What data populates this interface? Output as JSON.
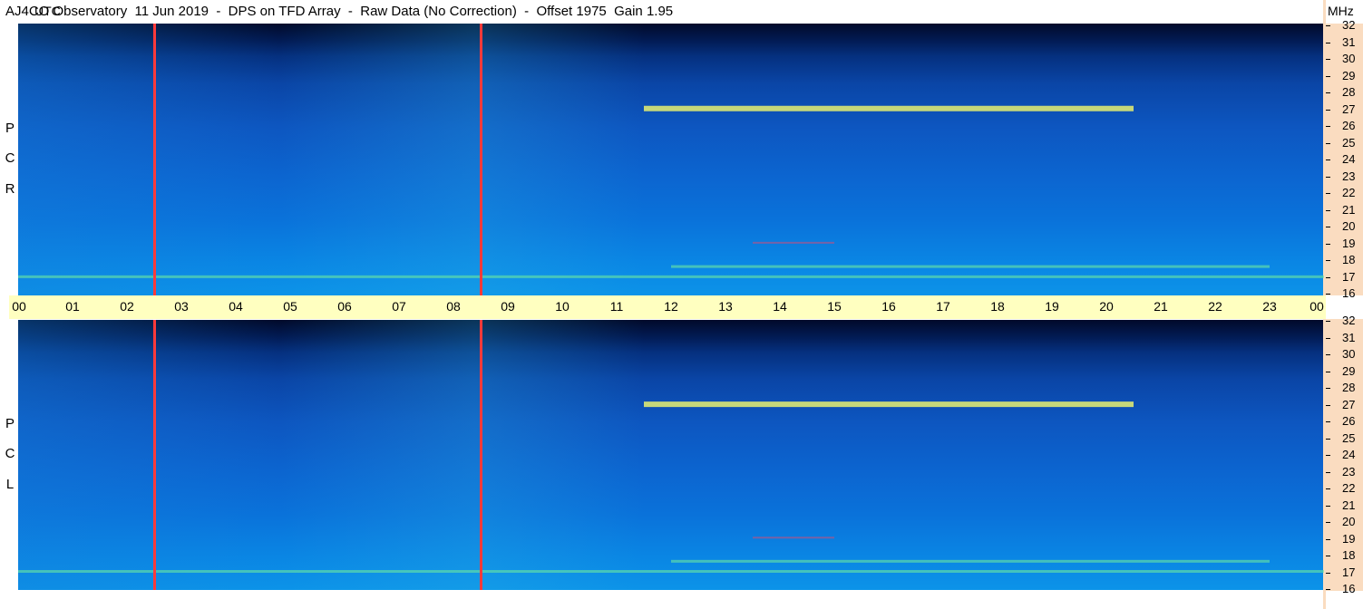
{
  "title": "AJ4CO Observatory  11 Jun 2019  -  DPS on TFD Array  -  Raw Data (No Correction)  -  Offset 1975  Gain 1.95",
  "panels": [
    {
      "name": "RCP",
      "label_letters": [
        "P",
        "C",
        "R"
      ]
    },
    {
      "name": "LCP",
      "label_letters": [
        "P",
        "C",
        "L"
      ]
    }
  ],
  "time_axis": {
    "utc_label": "UTC",
    "mhz_label": "MHz",
    "ticks": [
      "00",
      "01",
      "02",
      "03",
      "04",
      "05",
      "06",
      "07",
      "08",
      "09",
      "10",
      "11",
      "12",
      "13",
      "14",
      "15",
      "16",
      "17",
      "18",
      "19",
      "20",
      "21",
      "22",
      "23",
      "00"
    ]
  },
  "freq_axis": {
    "ticks": [
      "32",
      "31",
      "30",
      "29",
      "28",
      "27",
      "26",
      "25",
      "24",
      "23",
      "22",
      "21",
      "20",
      "19",
      "18",
      "17",
      "16"
    ],
    "range_mhz": [
      16,
      32
    ]
  },
  "colors": {
    "background_deep": "#010a2a",
    "background_mid": "#0c64cf",
    "background_low": "#0c93e8",
    "time_bar": "#ffffc0",
    "freq_axis": "#fadcc0",
    "marker_line": "#ff3a3a",
    "band_yellow": "#e8f070",
    "band_green": "#6ae8a0"
  },
  "chart_data": {
    "type": "heatmap",
    "title": "AJ4CO Observatory  11 Jun 2019  -  DPS on TFD Array  -  Raw Data (No Correction)  -  Offset 1975  Gain 1.95",
    "xlabel": "UTC",
    "ylabel": "MHz",
    "x_range_hours": [
      0,
      24
    ],
    "y_range_mhz": [
      16,
      32
    ],
    "panels": [
      "RCP",
      "LCP"
    ],
    "vertical_markers_utc_hours": [
      2.5,
      8.5
    ],
    "features": [
      {
        "type": "band",
        "panel": "RCP",
        "freq_mhz": 27.0,
        "start_h": 11.5,
        "end_h": 20.5,
        "intensity": "high"
      },
      {
        "type": "band",
        "panel": "LCP",
        "freq_mhz": 27.0,
        "start_h": 11.5,
        "end_h": 20.5,
        "intensity": "high"
      },
      {
        "type": "band",
        "panel": "RCP",
        "freq_mhz": 17.1,
        "start_h": 0.0,
        "end_h": 24.0,
        "intensity": "medium"
      },
      {
        "type": "band",
        "panel": "LCP",
        "freq_mhz": 17.1,
        "start_h": 0.0,
        "end_h": 24.0,
        "intensity": "medium"
      },
      {
        "type": "band",
        "panel": "RCP",
        "freq_mhz": 17.7,
        "start_h": 12.0,
        "end_h": 23.0,
        "intensity": "medium"
      },
      {
        "type": "band",
        "panel": "LCP",
        "freq_mhz": 17.7,
        "start_h": 12.0,
        "end_h": 23.0,
        "intensity": "medium"
      },
      {
        "type": "band",
        "panel": "RCP",
        "freq_mhz": 19.1,
        "start_h": 13.5,
        "end_h": 15.0,
        "intensity": "low"
      },
      {
        "type": "band",
        "panel": "LCP",
        "freq_mhz": 19.1,
        "start_h": 13.5,
        "end_h": 15.0,
        "intensity": "low"
      }
    ]
  }
}
